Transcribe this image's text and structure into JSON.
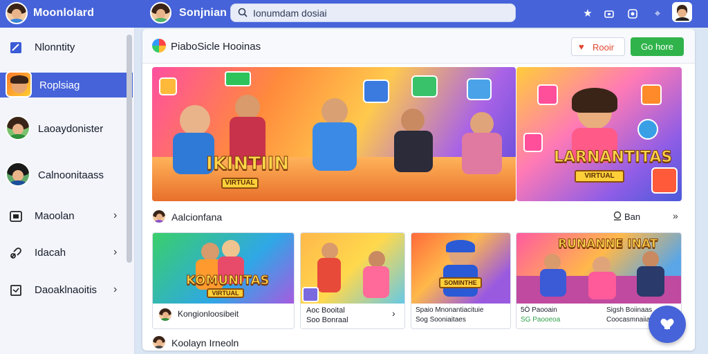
{
  "app": {
    "name": "Moonlolard",
    "user_name": "Sonjnian",
    "accent": "#4663d9"
  },
  "search": {
    "value": "Ionumdam dosiai"
  },
  "topbar": {
    "icons": [
      "star-icon",
      "gamepad-icon",
      "record-icon",
      "pin-icon",
      "profile-avatar"
    ]
  },
  "sidebar": {
    "items": [
      {
        "label": "Nlonntity",
        "icon": "square-icon",
        "active": false,
        "chevron": false
      },
      {
        "label": "Roplsiag",
        "icon": "game-thumb-icon",
        "active": true,
        "chevron": false
      },
      {
        "label": "Laoaydonister",
        "icon": "avatar-icon",
        "active": false,
        "chevron": false
      },
      {
        "label": "Calnoonitaass",
        "icon": "avatar-icon",
        "active": false,
        "chevron": false
      },
      {
        "label": "Maoolan",
        "icon": "monitor-icon",
        "active": false,
        "chevron": true
      },
      {
        "label": "Idacah",
        "icon": "link-icon",
        "active": false,
        "chevron": true
      },
      {
        "label": "Daoaklnaoitis",
        "icon": "checkbox-icon",
        "active": false,
        "chevron": true
      }
    ]
  },
  "main": {
    "title": "PiaboSicle Hooinas",
    "like_label": "Rooir",
    "action_label": "Go hore",
    "banner_left": {
      "headline": "IKINTIIN",
      "tag": "VIRTUAL"
    },
    "banner_right": {
      "headline": "LARNANTITAS",
      "tag": "VIRTUAL"
    },
    "section1": {
      "title": "Aalcionfana",
      "see_all": "Ban",
      "arrow": "»"
    },
    "section2": {
      "title": "Koolayn Irneoln"
    },
    "cards": [
      {
        "headline": "KOMUNITAS",
        "tag": "VIRTUAL",
        "line1": "Kongionloosibeit",
        "line2": ""
      },
      {
        "headline": "",
        "tag": "",
        "line1": "Aoc Booital",
        "line2": "Soo Bonraal"
      },
      {
        "headline": "",
        "tag": "SOMINTHE",
        "line1": "Spaio Mnonantiacituie",
        "line2": "Sog Sooniaitaes"
      },
      {
        "headline": "RUNANNE INAT",
        "tag": "",
        "line1": "5Ö Paooain",
        "line2": "SG Paooeoa",
        "line3": "Sigsh Boiinaas",
        "line4": "Coocasmnaiiad"
      }
    ]
  }
}
